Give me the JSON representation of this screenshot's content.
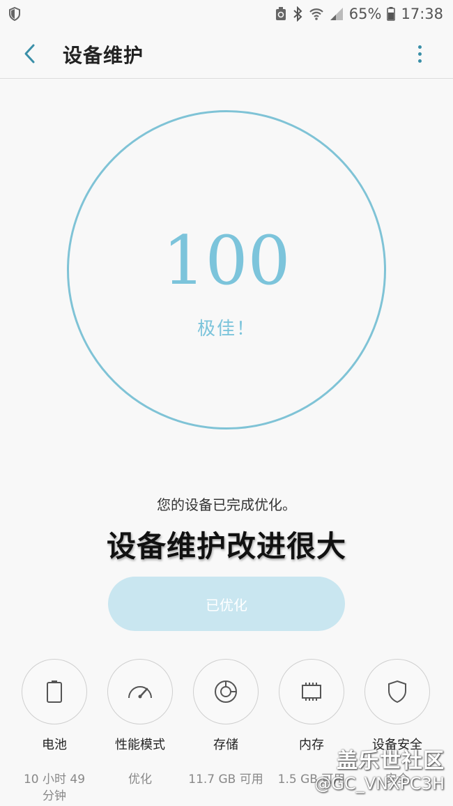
{
  "status_bar": {
    "battery_percent": "65%",
    "time": "17:38"
  },
  "app_bar": {
    "title": "设备维护"
  },
  "score": {
    "value": "100",
    "label": "极佳！"
  },
  "description": "您的设备已完成优化。",
  "headline": "设备维护改进很大",
  "optimize_button": "已优化",
  "items": [
    {
      "title": "电池",
      "value": "10 小时 49 分钟",
      "icon": "battery-icon"
    },
    {
      "title": "性能模式",
      "value": "优化",
      "icon": "speedometer-icon"
    },
    {
      "title": "存储",
      "value": "11.7 GB 可用",
      "icon": "storage-icon"
    },
    {
      "title": "内存",
      "value": "1.5 GB 可用",
      "icon": "memory-chip-icon"
    },
    {
      "title": "设备安全",
      "value": "安全",
      "icon": "shield-icon"
    }
  ],
  "watermark": {
    "line1": "盖乐世社区",
    "line2": "@GC_VNXPC3H"
  },
  "colors": {
    "accent": "#7cc4db",
    "button_bg": "#c9e6f0",
    "nav_accent": "#3a8fa8"
  }
}
